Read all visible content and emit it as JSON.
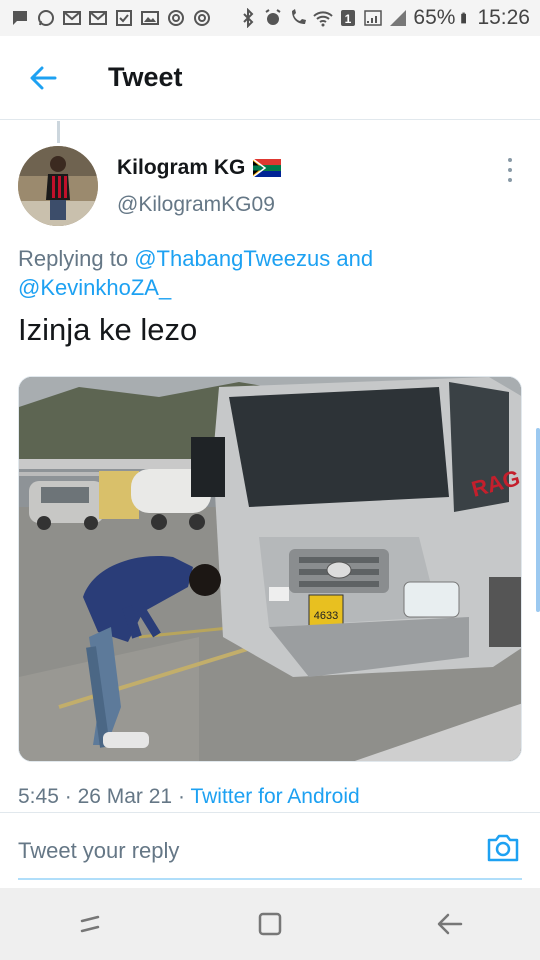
{
  "status_bar": {
    "battery": "65%",
    "time": "15:26",
    "sim_badge": "1"
  },
  "header": {
    "title": "Tweet"
  },
  "author": {
    "name": "Kilogram KG",
    "flag": "🇿🇦",
    "handle": "@KilogramKG09"
  },
  "reply_context": {
    "prefix": "Replying to",
    "mention_1": "@ThabangTweezus",
    "conjunction": "and",
    "mention_2": "@KevinkhoZA_"
  },
  "tweet": {
    "text": "Izinja ke lezo",
    "media": {
      "plate": "4633",
      "truck_brand": "RAG"
    },
    "time": "5:45",
    "date": "26 Mar 21",
    "separator": "·",
    "source": "Twitter for Android"
  },
  "reply": {
    "placeholder": "Tweet your reply"
  },
  "colors": {
    "accent": "#1da1f2",
    "text_primary": "#14171a",
    "text_secondary": "#657786",
    "divider": "#e1e8ed"
  }
}
